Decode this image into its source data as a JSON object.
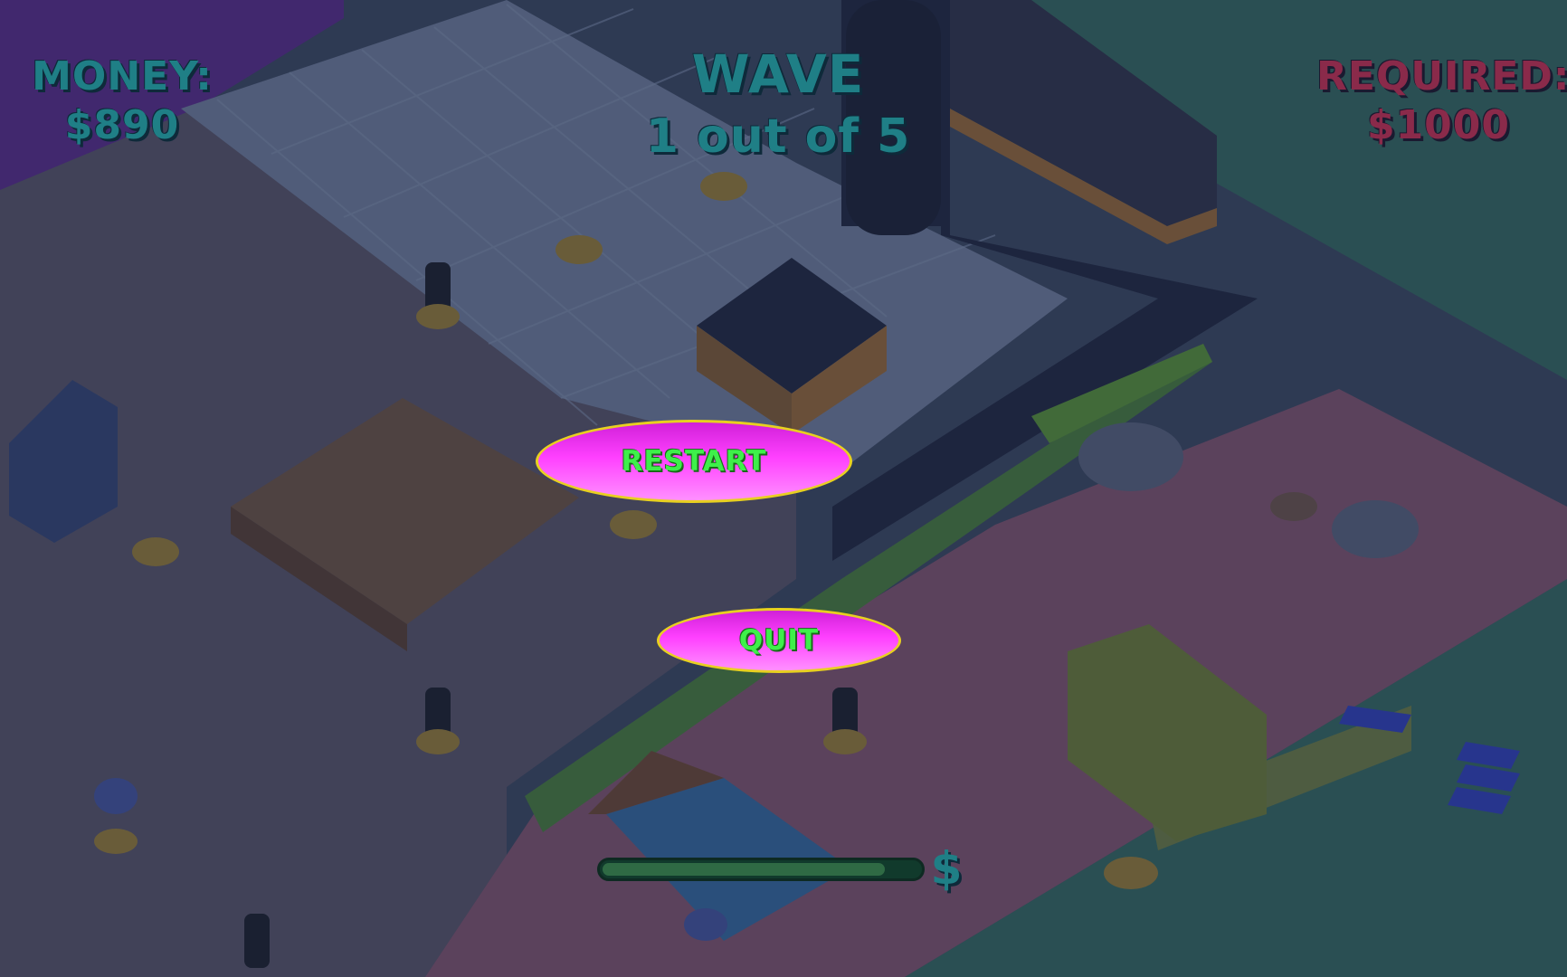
{
  "hud": {
    "money_label": "MONEY:",
    "money_value": "$890",
    "wave_label": "WAVE",
    "wave_value": "1 out of 5",
    "required_label": "REQUIRED:",
    "required_value": "$1000"
  },
  "menu": {
    "restart_label": "RESTART",
    "quit_label": "QUIT"
  },
  "progress": {
    "fraction": 0.89,
    "icon": "dollar-icon",
    "icon_glyph": "$"
  },
  "colors": {
    "hud_teal": "#1f7f86",
    "required_red": "#8a2a4a",
    "button_magenta": "#ff40ff",
    "button_text_green": "#3ef04a",
    "button_border_yellow": "#e8d020"
  }
}
